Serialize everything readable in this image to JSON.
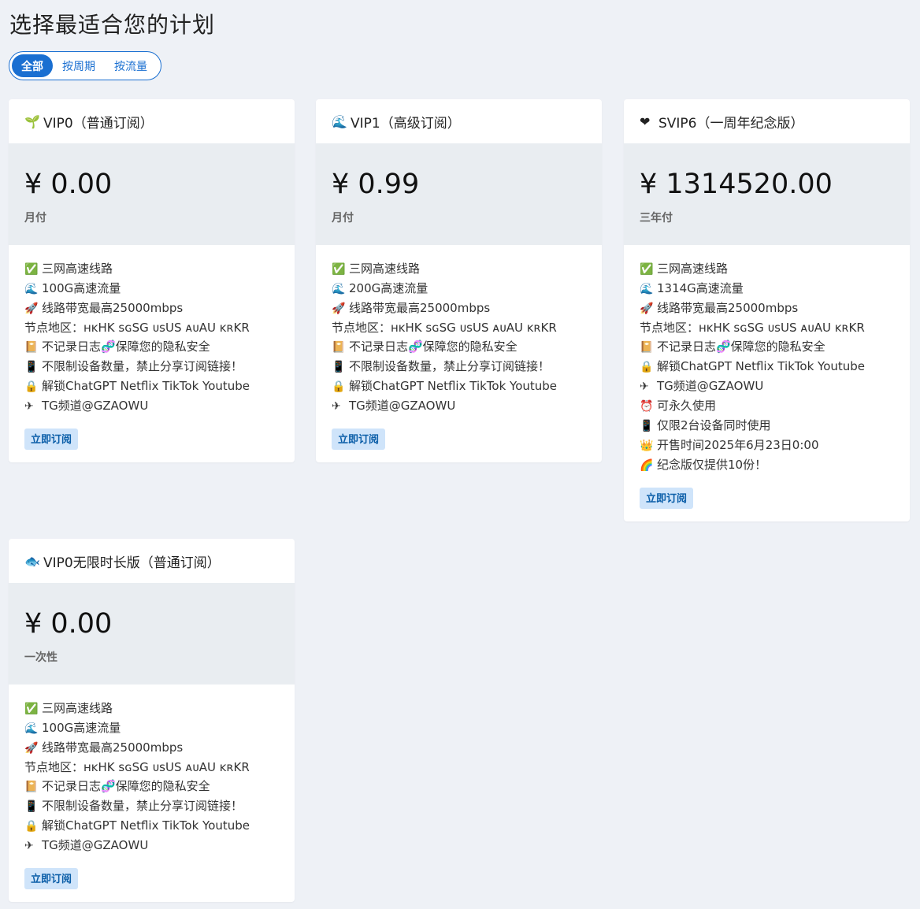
{
  "page": {
    "title": "选择最适合您的计划"
  },
  "filters": [
    {
      "label": "全部",
      "active": true
    },
    {
      "label": "按周期",
      "active": false
    },
    {
      "label": "按流量",
      "active": false
    }
  ],
  "plans": [
    {
      "icon": "🌱",
      "name": "VIP0（普通订阅）",
      "price": "¥ 0.00",
      "period": "月付",
      "features": [
        {
          "icon": "✅",
          "text": "三网高速线路"
        },
        {
          "icon": "🌊",
          "text": "100G高速流量"
        },
        {
          "icon": "🚀",
          "text": "线路带宽最高25000mbps"
        },
        {
          "icon": "",
          "text": "节点地区：ʜᴋHK sɢSG ᴜsUS ᴀᴜAU ᴋʀKR"
        },
        {
          "icon": "📔",
          "text": "不记录日志🧬保障您的隐私安全"
        },
        {
          "icon": "📱",
          "text": "不限制设备数量，禁止分享订阅链接！"
        },
        {
          "icon": "🔒",
          "text": "解锁ChatGPT Netflix TikTok Youtube"
        },
        {
          "icon": "✈",
          "text": "TG频道@GZAOWU"
        }
      ],
      "button": "立即订阅"
    },
    {
      "icon": "🌊",
      "name": "VIP1（高级订阅）",
      "price": "¥ 0.99",
      "period": "月付",
      "features": [
        {
          "icon": "✅",
          "text": "三网高速线路"
        },
        {
          "icon": "🌊",
          "text": "200G高速流量"
        },
        {
          "icon": "🚀",
          "text": "线路带宽最高25000mbps"
        },
        {
          "icon": "",
          "text": "节点地区：ʜᴋHK sɢSG ᴜsUS ᴀᴜAU ᴋʀKR"
        },
        {
          "icon": "📔",
          "text": "不记录日志🧬保障您的隐私安全"
        },
        {
          "icon": "📱",
          "text": "不限制设备数量，禁止分享订阅链接！"
        },
        {
          "icon": "🔒",
          "text": "解锁ChatGPT Netflix TikTok Youtube"
        },
        {
          "icon": "✈",
          "text": "TG频道@GZAOWU"
        }
      ],
      "button": "立即订阅"
    },
    {
      "icon": "❤",
      "name": "SVIP6（一周年纪念版）",
      "price": "¥ 1314520.00",
      "period": "三年付",
      "features": [
        {
          "icon": "✅",
          "text": "三网高速线路"
        },
        {
          "icon": "🌊",
          "text": "1314G高速流量"
        },
        {
          "icon": "🚀",
          "text": "线路带宽最高25000mbps"
        },
        {
          "icon": "",
          "text": "节点地区：ʜᴋHK sɢSG ᴜsUS ᴀᴜAU ᴋʀKR"
        },
        {
          "icon": "📔",
          "text": "不记录日志🧬保障您的隐私安全"
        },
        {
          "icon": "🔒",
          "text": "解锁ChatGPT Netflix TikTok Youtube"
        },
        {
          "icon": "✈",
          "text": "TG频道@GZAOWU"
        },
        {
          "icon": "⏰",
          "text": "可永久使用"
        },
        {
          "icon": "📱",
          "text": "仅限2台设备同时使用"
        },
        {
          "icon": "👑",
          "text": "开售时间2025年6月23日0:00"
        },
        {
          "icon": "🌈",
          "text": "纪念版仅提供10份！"
        }
      ],
      "button": "立即订阅"
    },
    {
      "icon": "🐟",
      "name": "VIP0无限时长版（普通订阅）",
      "price": "¥ 0.00",
      "period": "一次性",
      "features": [
        {
          "icon": "✅",
          "text": "三网高速线路"
        },
        {
          "icon": "🌊",
          "text": "100G高速流量"
        },
        {
          "icon": "🚀",
          "text": "线路带宽最高25000mbps"
        },
        {
          "icon": "",
          "text": "节点地区：ʜᴋHK sɢSG ᴜsUS ᴀᴜAU ᴋʀKR"
        },
        {
          "icon": "📔",
          "text": "不记录日志🧬保障您的隐私安全"
        },
        {
          "icon": "📱",
          "text": "不限制设备数量，禁止分享订阅链接！"
        },
        {
          "icon": "🔒",
          "text": "解锁ChatGPT Netflix TikTok Youtube"
        },
        {
          "icon": "✈",
          "text": "TG频道@GZAOWU"
        }
      ],
      "button": "立即订阅"
    }
  ],
  "icon_names": {
    "🌱": "seedling-icon",
    "🌊": "wave-icon",
    "❤": "heart-icon",
    "🐟": "fish-icon",
    "✅": "check-icon",
    "🚀": "rocket-icon",
    "📔": "notebook-icon",
    "📱": "phone-icon",
    "🔒": "lock-icon",
    "✈": "airplane-icon",
    "⏰": "alarm-clock-icon",
    "👑": "crown-icon",
    "🌈": "rainbow-icon"
  }
}
